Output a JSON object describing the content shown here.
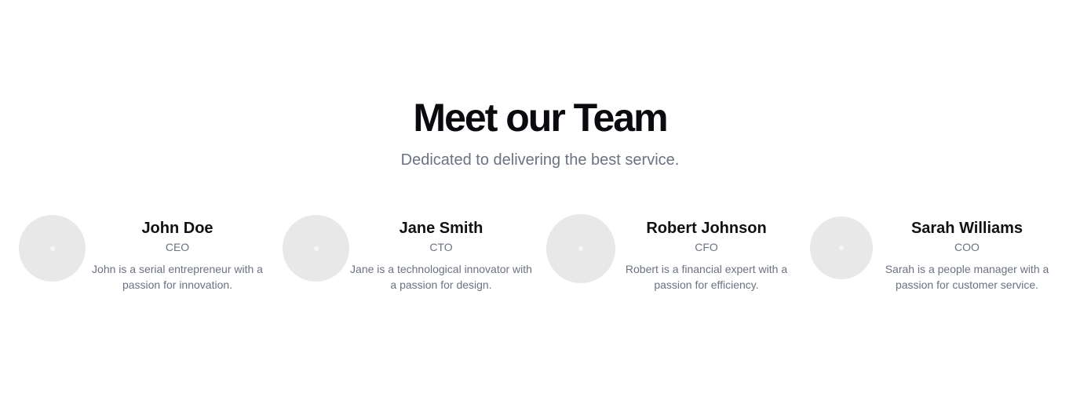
{
  "section": {
    "title": "Meet our Team",
    "subtitle": "Dedicated to delivering the best service."
  },
  "members": [
    {
      "name": "John Doe",
      "role": "CEO",
      "bio": "John is a serial entrepreneur with a passion for innovation."
    },
    {
      "name": "Jane Smith",
      "role": "CTO",
      "bio": "Jane is a technological innovator with a passion for design."
    },
    {
      "name": "Robert Johnson",
      "role": "CFO",
      "bio": "Robert is a financial expert with a passion for efficiency."
    },
    {
      "name": "Sarah Williams",
      "role": "COO",
      "bio": "Sarah is a people manager with a passion for customer service."
    }
  ]
}
